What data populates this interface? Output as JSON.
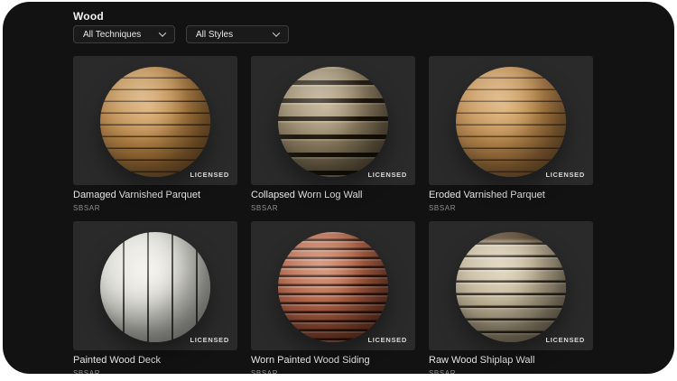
{
  "window": {
    "background": "#ffffff",
    "frame_color": "#121212",
    "tile_color": "#2b2a2a"
  },
  "header": {
    "title": "Wood"
  },
  "filters": {
    "techniques": {
      "label": "All Techniques"
    },
    "styles": {
      "label": "All Styles"
    }
  },
  "materials": [
    {
      "name": "Damaged Varnished Parquet",
      "format": "SBSAR",
      "badge": "LICENSED",
      "sphere": {
        "light": "#d8a869",
        "base": "#b5803f",
        "dark": "#5f4020",
        "line": "rgba(70,42,16,0.9)",
        "line_width": 1.5,
        "spacing": 13,
        "angle": 180
      }
    },
    {
      "name": "Collapsed Worn Log Wall",
      "format": "SBSAR",
      "badge": "LICENSED",
      "sphere": {
        "light": "#b7a787",
        "base": "#8f7f60",
        "dark": "#3a3020",
        "line": "rgba(18,12,5,0.92)",
        "line_width": 5,
        "spacing": 20,
        "angle": 180,
        "ridge_highlight": true
      }
    },
    {
      "name": "Eroded Varnished Parquet",
      "format": "SBSAR",
      "badge": "LICENSED",
      "sphere": {
        "light": "#d9a967",
        "base": "#bb8648",
        "dark": "#644323",
        "line": "rgba(70,42,16,0.8)",
        "line_width": 1.5,
        "spacing": 13,
        "angle": 180
      }
    },
    {
      "name": "Painted Wood Deck",
      "format": "SBSAR",
      "badge": "LICENSED",
      "sphere": {
        "light": "#f2f1eb",
        "base": "#dadad3",
        "dark": "#8b8a82",
        "line": "rgba(45,42,36,0.85)",
        "line_width": 2,
        "spacing": 27,
        "angle": 90
      }
    },
    {
      "name": "Worn Painted Wood Siding",
      "format": "SBSAR",
      "badge": "LICENSED",
      "sphere": {
        "light": "#cd7c58",
        "base": "#b05a3d",
        "dark": "#571f10",
        "line": "rgba(40,16,8,0.9)",
        "line_width": 2.5,
        "spacing": 10,
        "angle": 180,
        "ridge_highlight": true
      }
    },
    {
      "name": "Raw Wood Shiplap Wall",
      "format": "SBSAR",
      "badge": "LICENSED",
      "sphere": {
        "light": "#d9cdb0",
        "base": "#bfb193",
        "dark": "#5c5138",
        "line": "rgba(35,27,15,0.9)",
        "line_width": 2.5,
        "spacing": 14,
        "angle": 180,
        "ridge_highlight": true,
        "top_band": "rgba(74,53,28,0.9)"
      }
    }
  ]
}
